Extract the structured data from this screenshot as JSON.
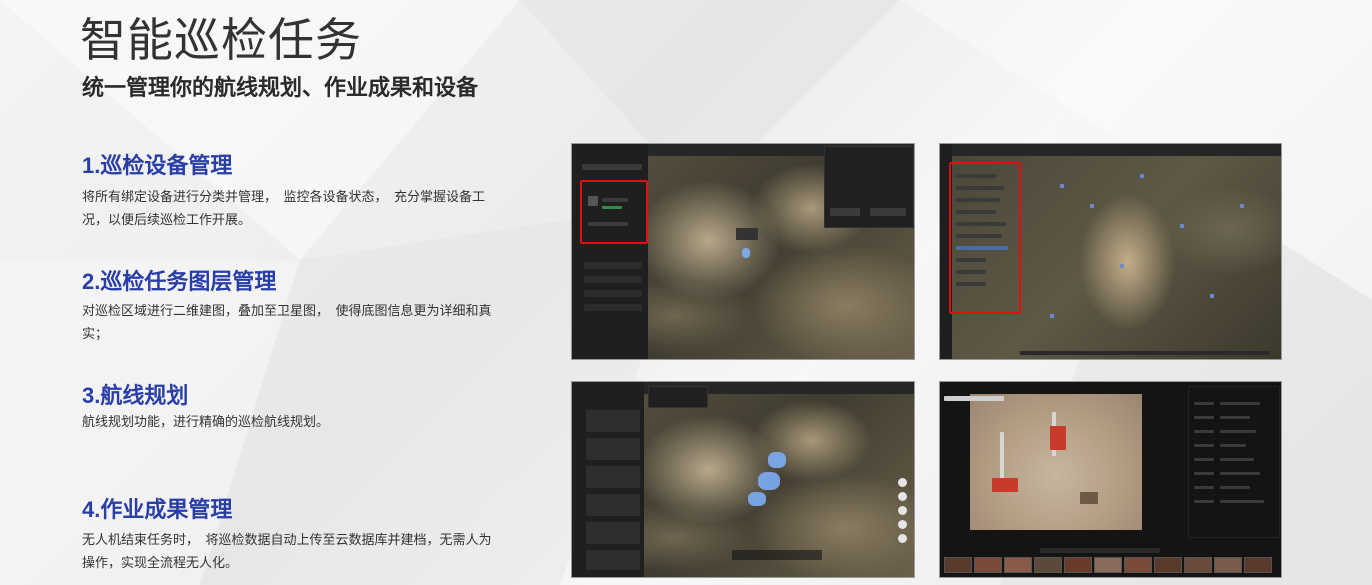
{
  "header": {
    "title": "智能巡检任务",
    "subtitle": "统一管理你的航线规划、作业成果和设备"
  },
  "sections": [
    {
      "heading": "1.巡检设备管理",
      "text": "将所有绑定设备进行分类并管理，　监控各设备状态，　充分掌握设备工况，以便后续巡检工作开展。"
    },
    {
      "heading": "2.巡检任务图层管理",
      "text": "对巡检区域进行二维建图，叠加至卫星图，　使得底图信息更为详细和真实；"
    },
    {
      "heading": "3.航线规划",
      "text": "航线规划功能，进行精确的巡检航线规划。"
    },
    {
      "heading": "4.作业成果管理",
      "text": "无人机结束任务时，　将巡检数据自动上传至云数据库并建档，无需人为操作，实现全流程无人化。"
    }
  ],
  "screenshots": [
    {
      "name": "device-management",
      "label": "设备管理界面"
    },
    {
      "name": "layer-management",
      "label": "图层管理界面"
    },
    {
      "name": "route-planning",
      "label": "航线规划界面"
    },
    {
      "name": "result-management",
      "label": "作业成果界面"
    }
  ],
  "colors": {
    "accent": "#2a3ea8",
    "highlight": "#e01010",
    "text": "#333333"
  }
}
